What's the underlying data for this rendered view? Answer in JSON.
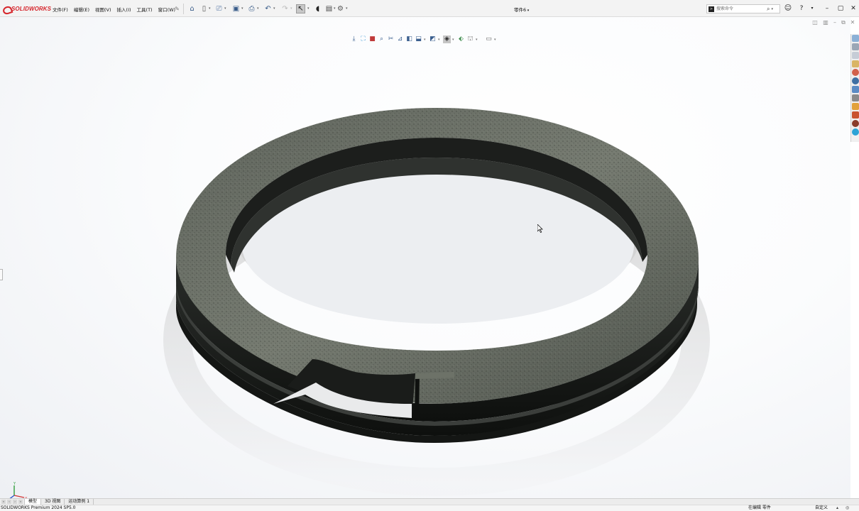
{
  "app": {
    "brand": "SOLIDWORKS",
    "document_title": "零件6"
  },
  "menu": {
    "items": [
      "文件(F)",
      "编辑(E)",
      "视图(V)",
      "插入(I)",
      "工具(T)",
      "窗口(W)"
    ]
  },
  "search": {
    "placeholder": "搜索命令"
  },
  "bottom_tabs": [
    "模型",
    "3D 视图",
    "运动算例 1"
  ],
  "status": {
    "product": "SOLIDWORKS Premium 2024 SP5.0",
    "edit_state": "在编辑 零件",
    "units": "自定义"
  },
  "triad": {
    "x": "X",
    "y": "Y",
    "z": "Z"
  },
  "colors": {
    "brand_red": "#d6262c",
    "ring_top": "#6b7066",
    "ring_side": "#1a1c1a"
  }
}
